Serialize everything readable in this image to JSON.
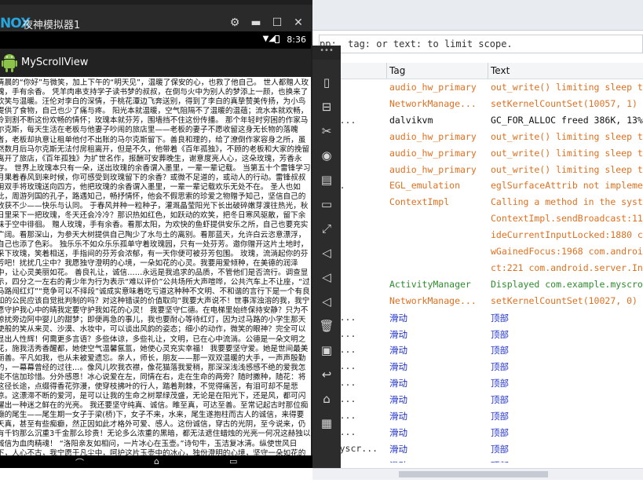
{
  "logcat": {
    "filter_text": "pp:, tag: or text: to limit scope.",
    "columns": {
      "tag": "Tag",
      "text": "Text"
    },
    "rows": [
      {
        "app": "",
        "tag": "audio_hw_primary",
        "text": "out_write() limiting sleep t",
        "color": "o"
      },
      {
        "app": "",
        "tag": "NetworkManage...",
        "text": "setKernelCountSet(10057, 1)",
        "color": "o"
      },
      {
        "app": "myscr...",
        "tag": "dalvikvm",
        "text": "GC_FOR_ALLOC freed 386K, 13%",
        "color": "k"
      },
      {
        "app": "",
        "tag": "audio_hw_primary",
        "text": "out_write() limiting sleep t",
        "color": "o"
      },
      {
        "app": "",
        "tag": "audio_hw_primary",
        "text": "out_write() limiting sleep t",
        "color": "o"
      },
      {
        "app": "",
        "tag": "audio_hw_primary",
        "text": "out_write() limiting sleep t",
        "color": "o"
      },
      {
        "app": "scr...",
        "tag": "EGL_emulation",
        "text": "eglSurfaceAttrib not impleme",
        "color": "o"
      },
      {
        "app": "",
        "tag": "ContextImpl",
        "text": "Calling a method in the syst",
        "color": "o"
      },
      {
        "app": "",
        "tag": "",
        "text": "ContextImpl.sendBroadcast:11",
        "color": "o"
      },
      {
        "app": "",
        "tag": "",
        "text": "ideCurrentInputLocked:1880 c",
        "color": "o"
      },
      {
        "app": "",
        "tag": "",
        "text": "wGainedFocus:1968 com.androi",
        "color": "o"
      },
      {
        "app": "",
        "tag": "",
        "text": "ct:221 com.android.server.In",
        "color": "o"
      },
      {
        "app": "",
        "tag": "ActivityManager",
        "text": "Displayed com.example.myscro",
        "color": "g"
      },
      {
        "app": "",
        "tag": "NetworkManage...",
        "text": "setKernelCountSet(10027, 0)",
        "color": "o"
      },
      {
        "app": "myscr...",
        "tag": "滑动",
        "text": "顶部",
        "color": "b"
      },
      {
        "app": "myscr...",
        "tag": "滑动",
        "text": "顶部",
        "color": "b"
      },
      {
        "app": "myscr...",
        "tag": "滑动",
        "text": "顶部",
        "color": "b"
      },
      {
        "app": "myscr...",
        "tag": "滑动",
        "text": "顶部",
        "color": "b"
      },
      {
        "app": "myscr...",
        "tag": "滑动",
        "text": "顶部",
        "color": "b"
      },
      {
        "app": "myscr...",
        "tag": "滑动",
        "text": "顶部",
        "color": "b"
      },
      {
        "app": "myscr...",
        "tag": "滑动",
        "text": "顶部",
        "color": "b"
      },
      {
        "app": "myscr...",
        "tag": "滑动",
        "text": "顶部",
        "color": "b"
      },
      {
        "app": "ple.myscr...",
        "tag": "滑动",
        "text": "顶部",
        "color": "b"
      },
      {
        "app": "ple.myscr...",
        "tag": "滑动",
        "text": "顶部",
        "color": "b"
      },
      {
        "app": "ple.myscr...",
        "tag": "滑动",
        "text": "顶部",
        "color": "b"
      }
    ]
  },
  "emulator": {
    "logo": "NOX",
    "title": "夜神模拟器1",
    "status_time": "8:36",
    "app_title": "MyScrollView",
    "article": "清晨的“你好”与微笑，加上下午的“明天见”，温暖了保安的心，也救了他自己。 世人都赠人玫瑰，手有余香。 凭羊肉串支持学子读书梦的叔叔，在倒与火中为别人的梦添上一颜，也换来了欢笑与温暖。汪伦对李白的深情，于桃花潭边飞奔送别，得到了李白的真挚赞美传扬，为小鸟提供了食物，自己也少了痛与疼。 阳光本就温暖，空气阻隔不了温暖的温蕴；流水本就欢畅，冷到割不断这份欢畅的情怀；玫瑰本就芬芳，围墙挡不住这份传播。 那个年轻时穷困的作家马尔克斯，每天生活在老板与他妻子吵闹的旅店里——老板的妻子不愿收留这身无长物的落魄者，老板却执意让租单他付不出账的马尔克斯留下。善良和理的，给了潦倒作家容身之所，虽然数月后马尔克斯无法付房租离开，但是不久，他带着《百年孤独》，不顾的老板和大家的挽留离开了旅店，《百年孤独》为扩世名作，报酬可安葬晚生，谢意度亮人心，这朵玫瑰，芳香永存。 世界上玫瑰本只有一朵，送出玫瑰的余香谓入墨里，一辈一辈记载。 当第五十个雷锋学习月果着春风到来时候，你可感受到玫瑰留下的余香？或微不足道的，或动人的行动。雷锋叔叔用双手将玫瑰送向四方，他把玫瑰的余香谓入墨里，一辈一辈记载欢乐无处不在。 圣人也如此，周游列国的孔子，路遇知己，畅抒情怀，他会不假思索的珍爱之物赠予知己，坚信自己的收获不少——快乐与认同。 于春风并种一粒种子，灌溉晶莹阳光下长出破碎嫩芽渡往热光，秋日里采下一把玫瑰，冬天还会冷冷？那识热如红色，如跃动的欢笑，把冬日寒风驱散，留下余味于空中徘徊。 赠人玫瑰，手有余香。看那太阳，为欢快的鱼虾提供安乐之所，自己也要充实广阔。看那深山，为参天大树提供自己陶少了水与土的离别。看那蓝天，允许白云恣意漂浮，自己也添了色彩。 独乐乐不如众乐乐孤单守着玫瑰园，只有一处芬芳。邀你赠开这片土地时，采下玫瑰，笑着相送，手指间的芬芳会浓郁，有一天你便可被芬芳包围。 玫瑰，流淌起你的芬芳吧！扰扰几尘中？我愿独守澄明的心境，一朵如花的心灵。我要用爱倾种，在美德的润泽中，让心灵美丽如花。 善良礼让，诚信……永远是我追求的品质，不管他们是否流行。调查显示，四分之一左右的青少年为行为表示“难以评价”公共场所大声喧哗，公共汽车上不让座，“过马路闯红灯”“竞争可以不择段”诚成实意味着吃亏道这种种不文明、不和谐的言行下是一个有良知的公民应该自觉批判制的吗？对这种错误的价值取向“我要大声说不！世事浑浊溶的我，我宁愿守护我心中的晴我定要守护我如花的心灵！ 我要坚守仁德。在电梯里始终保持安静？只为不惊扰旁边阿中婴儿的甜梦；即便再急的事儿，我也要耐心等待红灯，因为过马路的小学生那天使般的笑从来灵、沙漠、水妆中，可以谈出风韵的姿态；细小的动作，微笑的眼神？完全可以显出人性辉！何需更多言语？多些体谅，多些礼让，文明，已在心中流淌。公德是一朵文明之花，施我活秀香醒都，她使空气温馨氤氲，她使心灵充实幸福！ 我要要坚守爱。她是世间最美丽善。平凡如我，也从未被爱遗忘。亲人，师长，朋友——那一双双温暖的大手，一声声殷勤的，一幕幕曾经的过往…。像风儿吹我衣襟，像花猫落我爱稍，那深深浅浅感感不绝的爱我怎能不信加珍惜。分外感恩！冰心说爱在左，同情在右，走在生命的两旁？随时撒种，随花：将这径长途，点缀得香花弥漫，使穿枝拂叶的行人，踏着荆棘，不觉得痛苦，有泪可却不是悲凉。这漂滞不断的爱河，是可以让我的生命之树翠绿茂盛，无论是在阳光下，还是风，都可闪耀出一种迷之鲜在的光亮。 我还要坚守纯真、诚信。睢至真，可达至善。至常记起古时那位痴癫的尾生——尾生期一女子于梁(桥)下，女子不来，水来，尾生遂抱柱而古人的诚信，来得要天真，甚至有些痴癫，然正因如此才格外可爱、感人。这份诚信，穿古的光阴，至今说来，仍有千钧那么沉重3千金那么珍贵！无论多么浓重的黑暗，都无法遮住蜡烛的光亮一何况这赫独以诚信为血肉精魂！ “洛阳亲友如相问，一片冰心在玉壶。”诗句牛，玉洁复冰清。纵使世风日下，人心不古，我宁愿于凡尘中，呵护这片玉壶中的冰心，独份澄明的心境，坚守一朵如花的心灵。 在爱的阳光下，让心灵美丽如花！每天清晨的“你日微笑，加上下午的“明天见”，温暖了保安的心，也救了他自己。 世人都说：赠人玫瑰手有余香。 凭羊肉串支持学子读书梦的叔叔，在倒与火中为别人的梦添上一颜，也换来了欢笑与温暖。汪伦对李白的深情，于桃花潭边飞奔送别，得到了李白的真挚赞美传扬。"
  }
}
